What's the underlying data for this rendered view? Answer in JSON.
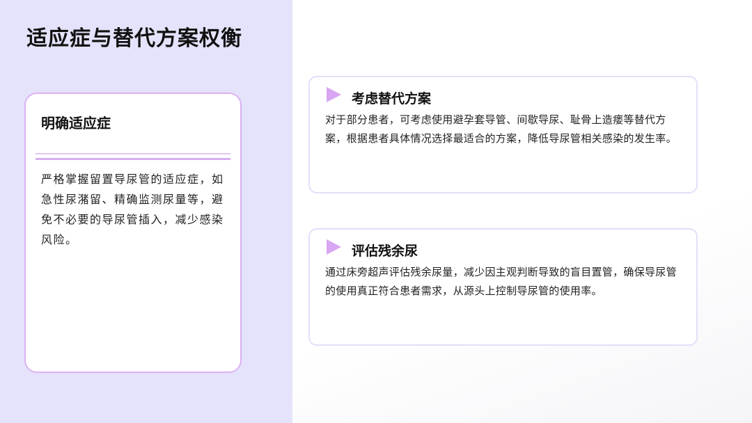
{
  "page": {
    "title": "适应症与替代方案权衡"
  },
  "indication_card": {
    "title": "明确适应症",
    "text": "严格掌握留置导尿管的适应症，如急性尿潴留、精确监测尿量等，避免不必要的导尿管插入，减少感染风险。"
  },
  "option_cards": [
    {
      "icon": "play-triangle-icon",
      "title": "考虑替代方案",
      "text": "对于部分患者，可考虑使用避孕套导管、间歇导尿、耻骨上造瘘等替代方案，根据患者具体情况选择最适合的方案，降低导尿管相关感染的发生率。"
    },
    {
      "icon": "play-triangle-icon",
      "title": "评估残余尿",
      "text": "通过床旁超声评估残余尿量，减少因主观判断导致的盲目置管，确保导尿管的使用真正符合患者需求，从源头上控制导尿管的使用率。"
    }
  ],
  "colors": {
    "left_panel_bg": "#e4e3fb",
    "accent_purple": "#d8a6f3",
    "card_border": "#e2dff8"
  }
}
